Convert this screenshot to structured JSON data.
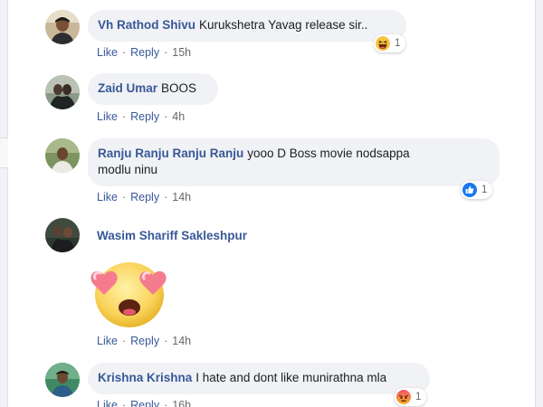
{
  "comments": [
    {
      "author": "Vh Rathod Shivu",
      "text": "Kurukshetra Yavag release sir..",
      "actions": {
        "like": "Like",
        "reply": "Reply",
        "time": "15h"
      },
      "reaction": {
        "icon": "haha-emoji-icon",
        "count": "1"
      }
    },
    {
      "author": "Zaid Umar",
      "text": "BOOS",
      "actions": {
        "like": "Like",
        "reply": "Reply",
        "time": "4h"
      }
    },
    {
      "author": "Ranju Ranju Ranju Ranju",
      "text_line1": "yooo D Boss movie nodsappa",
      "text_line2": "modlu ninu",
      "actions": {
        "like": "Like",
        "reply": "Reply",
        "time": "14h"
      },
      "reaction": {
        "icon": "like-thumbs-up-icon",
        "count": "1"
      }
    },
    {
      "author": "Wasim Shariff Sakleshpur",
      "sticker": "heart-eyes-emoji-sticker",
      "actions": {
        "like": "Like",
        "reply": "Reply",
        "time": "14h"
      }
    },
    {
      "author": "Krishna Krishna",
      "text": "I hate and dont like munirathna mla",
      "actions": {
        "like": "Like",
        "reply": "Reply",
        "time": "16h"
      },
      "reaction": {
        "icon": "angry-emoji-icon",
        "count": "1"
      }
    }
  ],
  "separator": "·",
  "colors": {
    "author": "#385898",
    "bubble": "#f0f2f5",
    "meta": "#65676b",
    "like_blue": "#1877f2",
    "angry_orange": "#f25268"
  }
}
